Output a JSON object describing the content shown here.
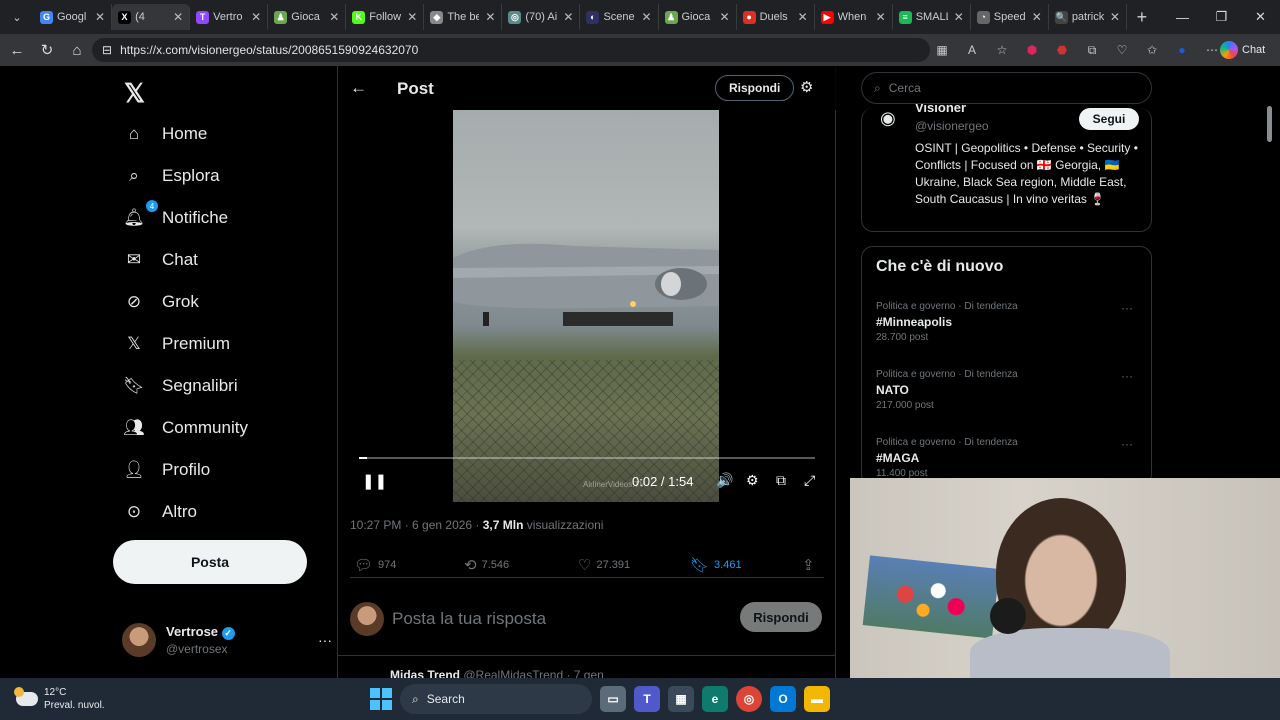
{
  "browser": {
    "tabs": [
      {
        "title": "Googl",
        "color": "#4285f4",
        "glyph": "G"
      },
      {
        "title": "(4",
        "color": "#000000",
        "glyph": "X",
        "active": true
      },
      {
        "title": "Vertro",
        "color": "#9146ff",
        "glyph": "T"
      },
      {
        "title": "Gioca",
        "color": "#6aa84f",
        "glyph": "♟"
      },
      {
        "title": "Follow",
        "color": "#53fc18",
        "glyph": "K"
      },
      {
        "title": "The be",
        "color": "#888888",
        "glyph": "◆"
      },
      {
        "title": "(70) Ai",
        "color": "#5a8a8a",
        "glyph": "◎"
      },
      {
        "title": "Scene",
        "color": "#303060",
        "glyph": "◐"
      },
      {
        "title": "Gioca",
        "color": "#6aa84f",
        "glyph": "♟"
      },
      {
        "title": "Duels",
        "color": "#d93025",
        "glyph": "●"
      },
      {
        "title": "When",
        "color": "#ff0000",
        "glyph": "▶"
      },
      {
        "title": "SMALL",
        "color": "#1db954",
        "glyph": "≡"
      },
      {
        "title": "Speed",
        "color": "#666666",
        "glyph": "◔"
      },
      {
        "title": "patrick",
        "color": "#444444",
        "glyph": "🔍"
      }
    ],
    "url": "https://x.com/visionergeo/status/2008651590924632070",
    "chat_label": "Chat"
  },
  "nav": {
    "items": [
      {
        "label": "Home",
        "icon": "home-icon"
      },
      {
        "label": "Esplora",
        "icon": "search-icon"
      },
      {
        "label": "Notifiche",
        "icon": "bell-icon",
        "badge": "4"
      },
      {
        "label": "Chat",
        "icon": "mail-icon"
      },
      {
        "label": "Grok",
        "icon": "grok-icon"
      },
      {
        "label": "Premium",
        "icon": "x-premium-icon"
      },
      {
        "label": "Segnalibri",
        "icon": "bookmark-icon"
      },
      {
        "label": "Community",
        "icon": "community-icon"
      },
      {
        "label": "Profilo",
        "icon": "profile-icon"
      },
      {
        "label": "Altro",
        "icon": "more-circle-icon"
      }
    ],
    "post_button": "Posta",
    "user": {
      "name": "Vertrose",
      "handle": "@vertrosex"
    }
  },
  "post": {
    "header_title": "Post",
    "reply_button_top": "Rispondi",
    "video": {
      "time": "0:02 / 1:54",
      "watermark": "AirlinerVideos.TV",
      "progress_fraction": 0.018
    },
    "timestamp": "10:27 PM · 6 gen 2026 · ",
    "views_count": "3,7 Mln",
    "views_label": " visualizzazioni",
    "stats": {
      "replies": "974",
      "reposts": "7.546",
      "likes": "27.391",
      "bookmarks": "3.461"
    },
    "reply_placeholder": "Posta la tua risposta",
    "reply_button": "Rispondi",
    "next_post_name": "Midas Trend",
    "next_post_meta": " @RealMidasTrend · 7 gen"
  },
  "sidebar": {
    "search_placeholder": "Cerca",
    "profile": {
      "name": "Visioner",
      "handle": "@visionergeo",
      "follow_button": "Segui",
      "bio": "OSINT | Geopolitics • Defense • Security • Conflicts | Focused on 🇬🇪 Georgia, 🇺🇦 Ukraine, Black Sea region, Middle East, South Caucasus | In vino veritas 🍷"
    },
    "trends_title": "Che c'è di nuovo",
    "trends": [
      {
        "category": "Politica e governo · Di tendenza",
        "tag": "#Minneapolis",
        "count": "28.700 post"
      },
      {
        "category": "Politica e governo · Di tendenza",
        "tag": "NATO",
        "count": "217.000 post"
      },
      {
        "category": "Politica e governo · Di tendenza",
        "tag": "#MAGA",
        "count": "11.400 post"
      }
    ]
  },
  "taskbar": {
    "temp": "12°C",
    "weather_desc": "Preval. nuvol.",
    "search_label": "Search"
  },
  "colors": {
    "accent": "#1d9bf0",
    "background": "#000000",
    "text": "#e7e9ea",
    "muted": "#71767b"
  }
}
